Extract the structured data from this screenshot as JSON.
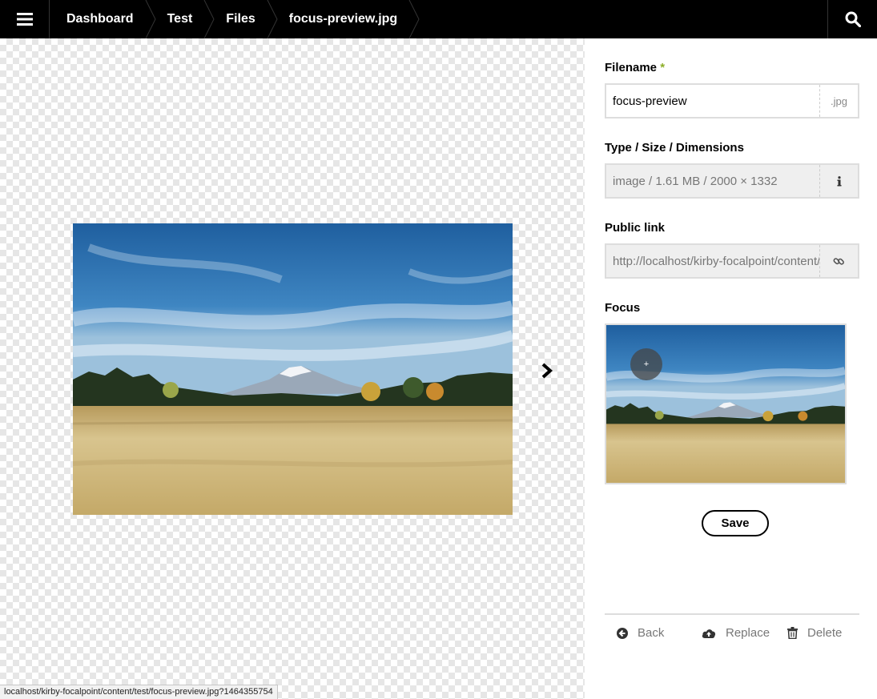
{
  "topbar": {
    "menu_icon": "hamburger-icon",
    "breadcrumbs": [
      "Dashboard",
      "Test",
      "Files",
      "focus-preview.jpg"
    ],
    "search_icon": "search-icon"
  },
  "preview": {
    "next_icon": "chevron-right-icon",
    "status_url": "localhost/kirby-focalpoint/content/test/focus-preview.jpg?1464355754"
  },
  "sidebar": {
    "filename": {
      "label": "Filename",
      "required_mark": "*",
      "value": "focus-preview",
      "extension": ".jpg"
    },
    "info": {
      "label": "Type / Size / Dimensions",
      "value": "image / 1.61 MB / 2000 × 1332",
      "icon": "info-icon"
    },
    "public_link": {
      "label": "Public link",
      "value": "http://localhost/kirby-focalpoint/content/test/focus-preview.jpg",
      "icon": "link-icon"
    },
    "focus": {
      "label": "Focus",
      "marker": "+"
    },
    "save_label": "Save",
    "actions": {
      "back": {
        "label": "Back",
        "icon": "arrow-circle-left-icon"
      },
      "replace": {
        "label": "Replace",
        "icon": "cloud-upload-icon"
      },
      "delete": {
        "label": "Delete",
        "icon": "trash-icon"
      }
    }
  },
  "colors": {
    "topbar": "#000000",
    "required": "#8dae28",
    "sky": "#2d6fae",
    "grass": "#d9c690"
  }
}
